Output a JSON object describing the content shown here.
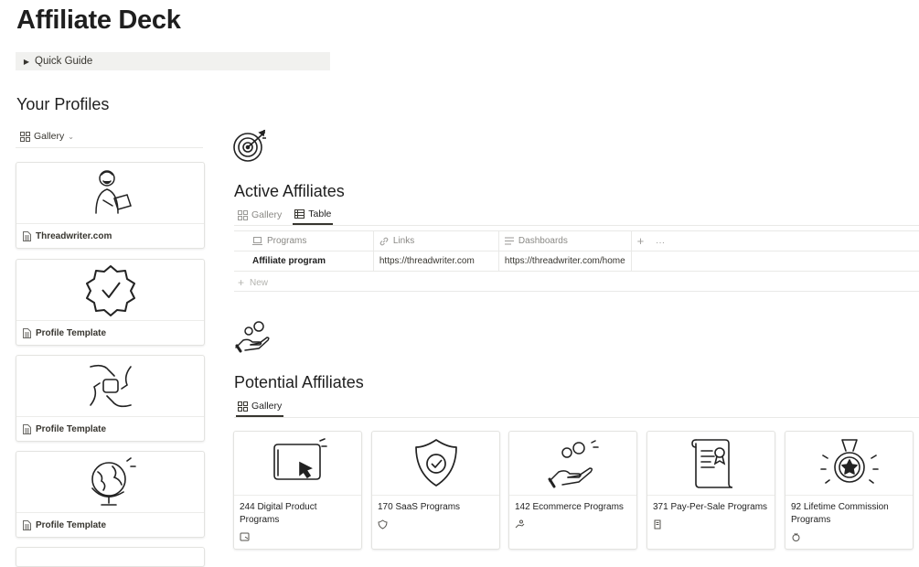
{
  "page": {
    "title": "Affiliate Deck"
  },
  "quick_guide": {
    "label": "Quick Guide"
  },
  "profiles": {
    "heading": "Your Profiles",
    "view_label": "Gallery",
    "cards": [
      {
        "label": "Threadwriter.com",
        "icon": "person-laptop-icon"
      },
      {
        "label": "Profile Template",
        "icon": "verified-badge-icon"
      },
      {
        "label": "Profile Template",
        "icon": "handshake-icon"
      },
      {
        "label": "Profile Template",
        "icon": "globe-icon"
      }
    ]
  },
  "active": {
    "heading": "Active Affiliates",
    "tabs": {
      "gallery": "Gallery",
      "table": "Table"
    },
    "columns": {
      "programs": "Programs",
      "links": "Links",
      "dashboards": "Dashboards"
    },
    "rows": [
      {
        "program": "Affiliate program",
        "link": "https://threadwriter.com",
        "dashboard": "https://threadwriter.com/home"
      }
    ],
    "new_label": "New"
  },
  "potential": {
    "heading": "Potential Affiliates",
    "tab": "Gallery",
    "cards": [
      {
        "label": "244 Digital Product Programs",
        "icon": "screen-cursor-icon"
      },
      {
        "label": "170 SaaS Programs",
        "icon": "shield-check-icon"
      },
      {
        "label": "142 Ecommerce Programs",
        "icon": "hand-coins-icon"
      },
      {
        "label": "371 Pay-Per-Sale Programs",
        "icon": "scroll-certificate-icon"
      },
      {
        "label": "92 Lifetime Commission Programs",
        "icon": "medal-star-icon"
      }
    ]
  }
}
